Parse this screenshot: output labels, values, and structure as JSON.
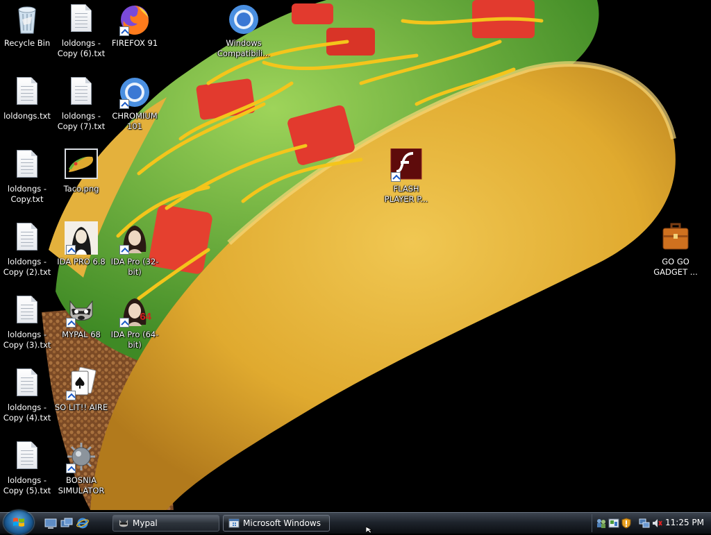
{
  "desktop": {
    "icons": [
      {
        "label": "Recycle Bin"
      },
      {
        "label": "loldongs - Copy (6).txt"
      },
      {
        "label": "FIREFOX 91"
      },
      {
        "label": "Windows Compatibili..."
      },
      {
        "label": "loldongs.txt"
      },
      {
        "label": "loldongs - Copy (7).txt"
      },
      {
        "label": "CHROMIUM 101"
      },
      {
        "label": "loldongs - Copy.txt"
      },
      {
        "label": "Taco.png"
      },
      {
        "label": "FLASH PLAYER P..."
      },
      {
        "label": "loldongs - Copy (2).txt"
      },
      {
        "label": "IDA PRO 6.8"
      },
      {
        "label": "IDA Pro (32-bit)"
      },
      {
        "label": "GO GO GADGET ..."
      },
      {
        "label": "loldongs - Copy (3).txt"
      },
      {
        "label": "MYPAL 68"
      },
      {
        "label": "IDA Pro (64-bit)"
      },
      {
        "label": "loldongs - Copy (4).txt"
      },
      {
        "label": "SO LIT!! AIRE"
      },
      {
        "label": "loldongs - Copy (5).txt"
      },
      {
        "label": "BOSNIA SIMULATOR"
      }
    ],
    "ida64_badge": "64"
  },
  "taskbar": {
    "buttons": [
      {
        "label": "Mypal"
      },
      {
        "label": "Microsoft Windows"
      }
    ],
    "clock": "11:25 PM"
  },
  "colors": {
    "background": "#000000",
    "taco_shell": "#e6b531",
    "lettuce": "#69b53a",
    "tomato": "#e23a2e",
    "cheese": "#f4c51b",
    "meat": "#8a5a30"
  }
}
